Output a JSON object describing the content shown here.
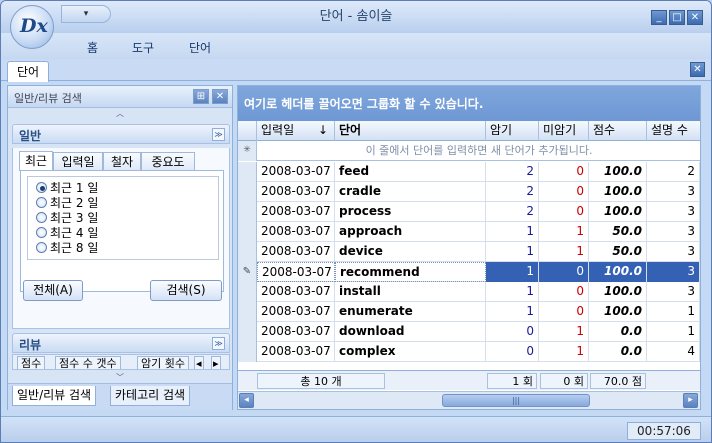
{
  "app": {
    "title": "단어 - 솜이슬",
    "logo_text": "Dx",
    "qat_icon": "▾",
    "window_buttons": {
      "minimize": "_",
      "maximize": "□",
      "close": "✕"
    }
  },
  "menu": [
    "홈",
    "도구",
    "단어"
  ],
  "doc_tab": {
    "label": "단어",
    "close": "✕"
  },
  "left_panel": {
    "title": "일반/리뷰 검색",
    "pin_icon": "⊞",
    "close_icon": "✕",
    "up_arrow": "︿",
    "down_arrow": "﹀",
    "section_general": {
      "title": "일반",
      "collapse": "≫"
    },
    "filter_tabs": [
      "최근",
      "입력일",
      "철자",
      "중요도"
    ],
    "radios": [
      {
        "label": "최근 1 일",
        "selected": true
      },
      {
        "label": "최근 2 일",
        "selected": false
      },
      {
        "label": "최근 3 일",
        "selected": false
      },
      {
        "label": "최근 4 일",
        "selected": false
      },
      {
        "label": "최근 8 일",
        "selected": false
      }
    ],
    "all_button": "전체(A)",
    "search_button": "검색(S)",
    "section_review": {
      "title": "리뷰",
      "collapse": "≫"
    },
    "review_tabs": [
      "점수",
      "점수 수 갯수",
      "암기 횟수"
    ],
    "review_nav": {
      "prev": "◂",
      "next": "▸"
    },
    "bottom_tabs": [
      "일반/리뷰 검색",
      "카테고리 검색"
    ]
  },
  "grid": {
    "group_hint": "여기로 헤더를 끌어오면 그룹화 할 수 있습니다.",
    "columns": [
      "입력일",
      "단어",
      "암기",
      "미암기",
      "점수",
      "설명 수"
    ],
    "sort_icon": "↓",
    "new_row_indicator": "✳",
    "new_row_hint": "이 줄에서 단어를 입력하면 새 단어가 추가됩니다.",
    "edit_icon": "✎",
    "rows": [
      {
        "date": "2008-03-07",
        "word": "feed",
        "memorized": "2",
        "unmemorized": "0",
        "score": "100.0",
        "desc": "2",
        "selected": false
      },
      {
        "date": "2008-03-07",
        "word": "cradle",
        "memorized": "2",
        "unmemorized": "0",
        "score": "100.0",
        "desc": "3",
        "selected": false
      },
      {
        "date": "2008-03-07",
        "word": "process",
        "memorized": "2",
        "unmemorized": "0",
        "score": "100.0",
        "desc": "3",
        "selected": false
      },
      {
        "date": "2008-03-07",
        "word": "approach",
        "memorized": "1",
        "unmemorized": "1",
        "score": "50.0",
        "desc": "3",
        "selected": false
      },
      {
        "date": "2008-03-07",
        "word": "device",
        "memorized": "1",
        "unmemorized": "1",
        "score": "50.0",
        "desc": "3",
        "selected": false
      },
      {
        "date": "2008-03-07",
        "word": "recommend",
        "memorized": "1",
        "unmemorized": "0",
        "score": "100.0",
        "desc": "3",
        "selected": true
      },
      {
        "date": "2008-03-07",
        "word": "install",
        "memorized": "1",
        "unmemorized": "0",
        "score": "100.0",
        "desc": "3",
        "selected": false
      },
      {
        "date": "2008-03-07",
        "word": "enumerate",
        "memorized": "1",
        "unmemorized": "0",
        "score": "100.0",
        "desc": "1",
        "selected": false
      },
      {
        "date": "2008-03-07",
        "word": "download",
        "memorized": "0",
        "unmemorized": "1",
        "score": "0.0",
        "desc": "1",
        "selected": false
      },
      {
        "date": "2008-03-07",
        "word": "complex",
        "memorized": "0",
        "unmemorized": "1",
        "score": "0.0",
        "desc": "4",
        "selected": false
      }
    ],
    "footer": {
      "total": "총 10 개",
      "memorized_sum": "1 회",
      "unmemorized_sum": "0 회",
      "score_avg": "70.0 점"
    },
    "scroll": {
      "left": "◂",
      "right": "▸",
      "thumb": "|||"
    }
  },
  "status": {
    "time": "00:57:06"
  },
  "colors": {
    "selection": "#3461b4",
    "memorized": "#1a1a9c",
    "unmemorized": "#cc0000",
    "group_bar": "#7fa6dc"
  }
}
